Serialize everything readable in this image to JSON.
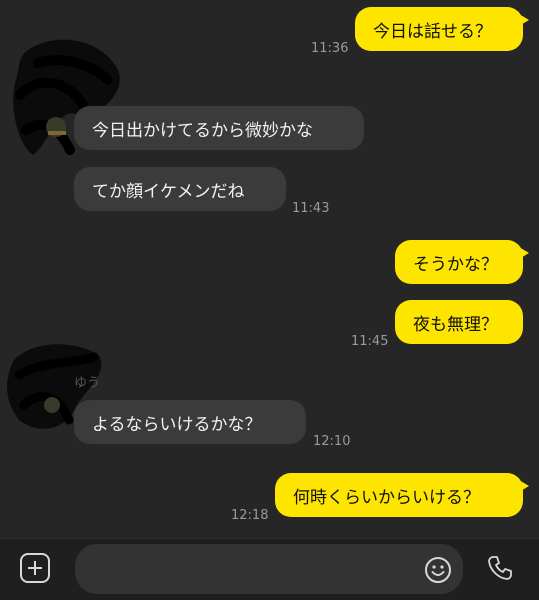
{
  "chat": {
    "sender_name": "ゆう",
    "messages": [
      {
        "id": "m1",
        "direction": "out",
        "text": "今日は話せる？",
        "time": "11:36"
      },
      {
        "id": "m2",
        "direction": "in",
        "text": "今日出かけてるから微妙かな",
        "time": ""
      },
      {
        "id": "m3",
        "direction": "in",
        "text": "てか顔イケメンだね",
        "time": "11:43"
      },
      {
        "id": "m4",
        "direction": "out",
        "text": "そうかな？",
        "time": ""
      },
      {
        "id": "m5",
        "direction": "out",
        "text": "夜も無理？",
        "time": "11:45"
      },
      {
        "id": "m6",
        "direction": "in",
        "text": "よるならいけるかな？",
        "time": "12:10"
      },
      {
        "id": "m7",
        "direction": "out",
        "text": "何時くらいからいける？",
        "time": "12:18"
      }
    ]
  },
  "composer": {
    "value": "",
    "icons": [
      "plus-icon",
      "emoji-icon",
      "phone-icon"
    ]
  },
  "colors": {
    "background": "#262626",
    "outgoing_bubble": "#fde500",
    "incoming_bubble": "#3b3b3b",
    "timestamp": "#9a9a9a"
  }
}
